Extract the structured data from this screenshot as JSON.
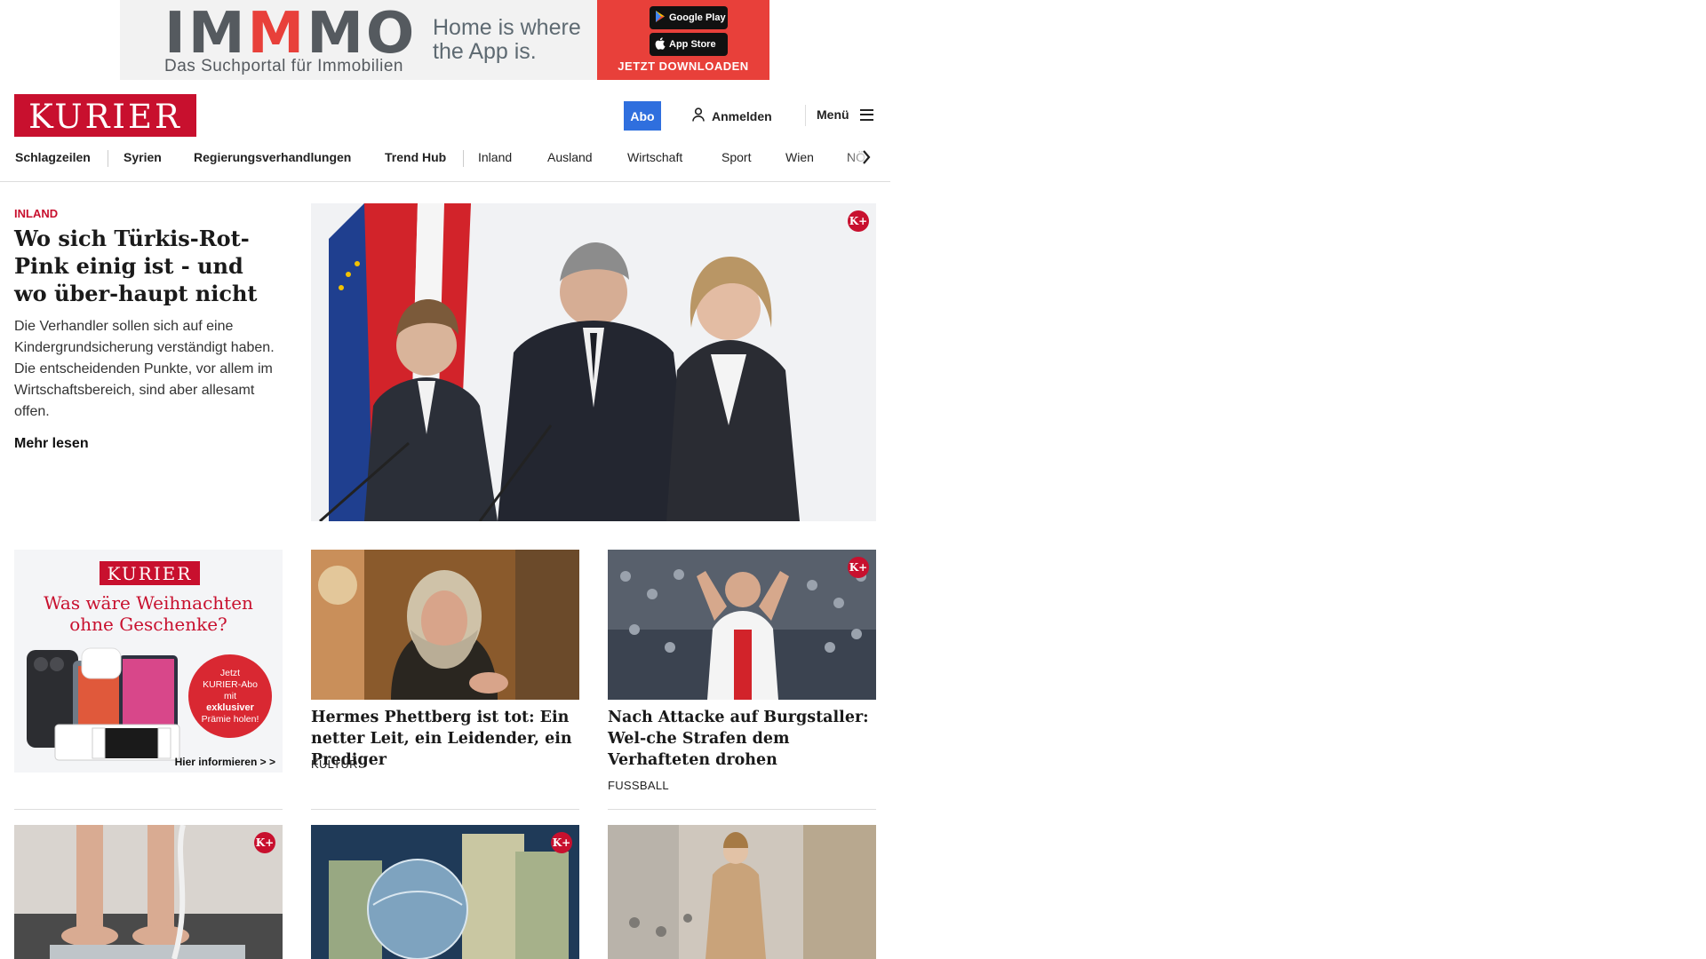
{
  "ad": {
    "logo_i1": "IM",
    "logo_m": "M",
    "logo_rest": "MO",
    "subtitle": "Das Suchportal für Immobilien",
    "tagline": "Home is where the App is.",
    "google_play": "Google Play",
    "app_store": "App Store",
    "cta": "JETZT DOWNLOADEN"
  },
  "header": {
    "logo": "KURIER",
    "abo": "Abo",
    "login": "Anmelden",
    "menu": "Menü"
  },
  "nav": {
    "items": [
      "Schlagzeilen",
      "Syrien",
      "Regierungsverhandlungen",
      "Trend Hub",
      "Inland",
      "Ausland",
      "Wirtschaft",
      "Sport",
      "Wien",
      "NÖ"
    ]
  },
  "lead": {
    "kicker": "INLAND",
    "title": "Wo sich Türkis-Rot-Pink einig ist - und wo über-haupt nicht",
    "teaser": "Die Verhandler sollen sich auf eine Kindergrundsicherung verständigt haben. Die entscheidenden Punkte, vor allem im Wirtschaftsbereich, sind aber allesamt offen.",
    "more": "Mehr lesen",
    "premium_badge": "K+"
  },
  "promo": {
    "logo": "KURIER",
    "headline_1": "Was wäre Weihnachten",
    "headline_2": "ohne Geschenke?",
    "badge_1": "Jetzt",
    "badge_2": "KURIER-Abo",
    "badge_3": "mit",
    "badge_4": "exklusiver",
    "badge_5": "Prämie holen!",
    "info": "Hier informieren > >"
  },
  "cards": [
    {
      "title": "Hermes Phettberg ist tot: Ein netter Leit, ein Leidender, ein Prediger",
      "category": "KULTUR",
      "premium": false
    },
    {
      "title": "Nach Attacke auf Burgstaller: Wel-che Strafen dem Verhafteten drohen",
      "category": "FUSSBALL",
      "premium": true,
      "premium_badge": "K+"
    }
  ],
  "bottom_cards": [
    {
      "premium": true,
      "premium_badge": "K+"
    },
    {
      "premium": true,
      "premium_badge": "K+"
    },
    {
      "premium": false
    }
  ],
  "colors": {
    "brand_red": "#c8102e",
    "abo_blue": "#2f6fde",
    "ad_red": "#e8403a"
  }
}
